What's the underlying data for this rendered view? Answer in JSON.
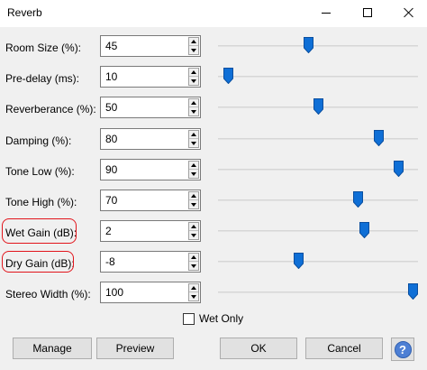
{
  "window": {
    "title": "Reverb",
    "minimize_icon": "minimize-icon",
    "maximize_icon": "maximize-icon",
    "close_icon": "close-icon"
  },
  "params": [
    {
      "label": "Room Size (%):",
      "value": "45",
      "level": 0.45
    },
    {
      "label": "Pre-delay (ms):",
      "value": "10",
      "level": 0.05
    },
    {
      "label": "Reverberance (%):",
      "value": "50",
      "level": 0.5
    },
    {
      "label": "Damping (%):",
      "value": "80",
      "level": 0.8
    },
    {
      "label": "Tone Low (%):",
      "value": "90",
      "level": 0.9
    },
    {
      "label": "Tone High (%):",
      "value": "70",
      "level": 0.7
    },
    {
      "label": "Wet Gain (dB):",
      "value": "2",
      "level": 0.73
    },
    {
      "label": "Dry Gain (dB):",
      "value": "-8",
      "level": 0.4
    },
    {
      "label": "Stereo Width (%):",
      "value": "100",
      "level": 1.0
    }
  ],
  "wet_only": {
    "label": "Wet Only",
    "checked": false
  },
  "buttons": {
    "manage": "Manage",
    "preview": "Preview",
    "ok": "OK",
    "cancel": "Cancel",
    "help": "?"
  },
  "colors": {
    "thumb": "#0f6fd6",
    "annotation": "#e2141b",
    "help": "#4d7fd4"
  }
}
